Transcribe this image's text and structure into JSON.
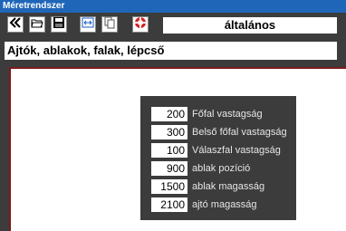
{
  "window": {
    "title": "Méretrendszer"
  },
  "toolbar": {
    "buttons": [
      {
        "icon": "double-chevron-left-icon"
      },
      {
        "icon": "open-folder-icon"
      },
      {
        "icon": "floppy-save-icon"
      },
      {
        "icon": "fit-width-icon"
      },
      {
        "icon": "copy-pages-icon"
      },
      {
        "icon": "lifebuoy-help-icon"
      }
    ],
    "mode": "általános"
  },
  "section": "Ajtók, ablakok, falak, lépcső",
  "fields": [
    {
      "value": "200",
      "label": "Főfal vastagság"
    },
    {
      "value": "300",
      "label": "Belső főfal vastagság"
    },
    {
      "value": "100",
      "label": "Válaszfal vastagság"
    },
    {
      "value": "900",
      "label": "ablak pozíció"
    },
    {
      "value": "1500",
      "label": "ablak magasság"
    },
    {
      "value": "2100",
      "label": "ajtó magasság"
    }
  ],
  "colors": {
    "titlebar": "#1f66b8",
    "accent": "#7a1a1a",
    "background": "#3c3c3c"
  }
}
